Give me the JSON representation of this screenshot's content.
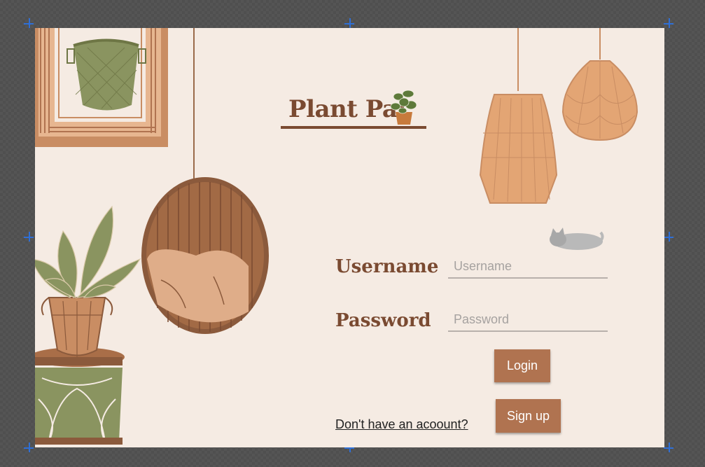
{
  "app": {
    "title": "Plant Pal"
  },
  "form": {
    "username_label": "Username",
    "username_placeholder": "Username",
    "username_value": "",
    "password_label": "Password",
    "password_placeholder": "Password",
    "password_value": "",
    "login_label": "Login",
    "signup_prompt": "Don't have an acoount?",
    "signup_label": "Sign up"
  },
  "icons": {
    "logo": "potted-plant-icon",
    "cat": "sleeping-cat-icon"
  },
  "colors": {
    "background": "#f5ebe3",
    "accent": "#b07350",
    "heading": "#7a4a31",
    "rattan": "#8b5a3c",
    "lamp": "#e0a070",
    "leaf": "#8a9460",
    "workspace": "#555555",
    "selection_handle": "#2f6fd6"
  }
}
